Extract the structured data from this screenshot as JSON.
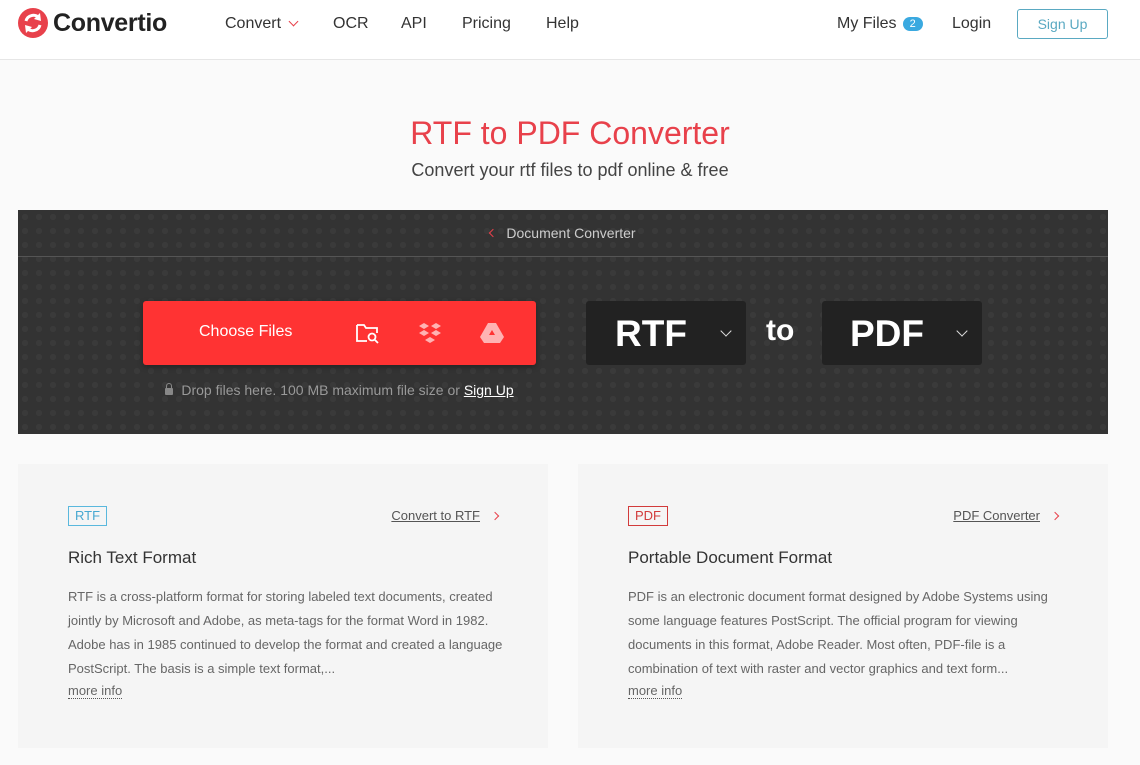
{
  "header": {
    "brand": "Convertio",
    "nav": [
      {
        "label": "Convert",
        "has_dropdown": true
      },
      {
        "label": "OCR"
      },
      {
        "label": "API"
      },
      {
        "label": "Pricing"
      },
      {
        "label": "Help"
      }
    ],
    "my_files_label": "My Files",
    "my_files_count": "2",
    "login_label": "Login",
    "signup_label": "Sign Up"
  },
  "hero": {
    "title": "RTF to PDF Converter",
    "subtitle": "Convert your rtf files to pdf online & free"
  },
  "converter": {
    "breadcrumb": "Document Converter",
    "choose_files_label": "Choose Files",
    "sources": [
      "folder-search-icon",
      "dropbox-icon",
      "google-drive-icon"
    ],
    "drop_hint": "Drop files here. 100 MB maximum file size or",
    "drop_signup": "Sign Up",
    "from_format": "RTF",
    "to_label": "to",
    "to_format": "PDF"
  },
  "cards": [
    {
      "tag": "RTF",
      "link": "Convert to RTF",
      "title": "Rich Text Format",
      "description": "RTF is a cross-platform format for storing labeled text documents, created jointly by Microsoft and Adobe, as meta-tags for the format Word in 1982. Adobe has in 1985 continued to develop the format and created a language PostScript. The basis is a simple text format,...",
      "more": "more info"
    },
    {
      "tag": "PDF",
      "link": "PDF Converter",
      "title": "Portable Document Format",
      "description": "PDF is an electronic document format designed by Adobe Systems using some language features PostScript. The official program for viewing documents in this format, Adobe Reader. Most often, PDF-file is a combination of text with raster and vector graphics and text form...",
      "more": "more info"
    }
  ],
  "colors": {
    "accent_red": "#ff3333",
    "title_red": "#e8414b",
    "badge_blue": "#3aa9e0",
    "signup_teal": "#5aa9c2",
    "panel_dark": "#333333"
  }
}
